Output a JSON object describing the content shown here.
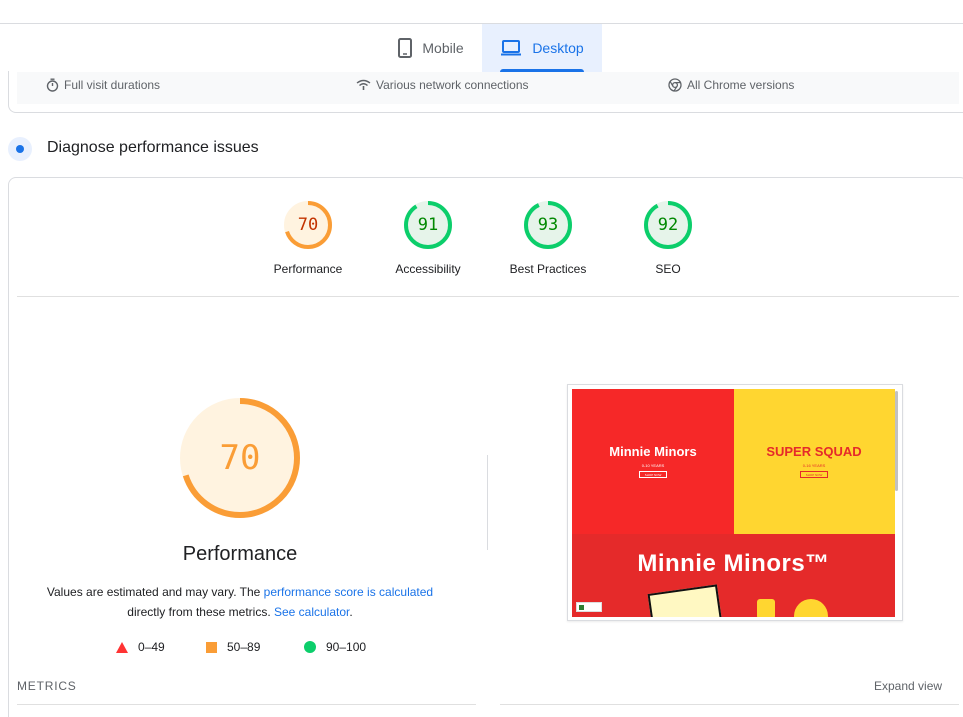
{
  "tabs": {
    "mobile": {
      "label": "Mobile",
      "icon": "phone-icon"
    },
    "desktop": {
      "label": "Desktop",
      "icon": "laptop-icon",
      "selected": true
    }
  },
  "info_strip": {
    "items": [
      {
        "label": "Full visit durations",
        "icon": "stopwatch-icon"
      },
      {
        "label": "Various network connections",
        "icon": "wifi-icon"
      },
      {
        "label": "All Chrome versions",
        "icon": "chrome-icon"
      }
    ]
  },
  "diagnose": {
    "title": "Diagnose performance issues"
  },
  "scores": [
    {
      "value": "70",
      "label": "Performance",
      "score": 0.7,
      "status": "average"
    },
    {
      "value": "91",
      "label": "Accessibility",
      "score": 0.91,
      "status": "good"
    },
    {
      "value": "93",
      "label": "Best Practices",
      "score": 0.93,
      "status": "good"
    },
    {
      "value": "92",
      "label": "SEO",
      "score": 0.92,
      "status": "good"
    }
  ],
  "colors": {
    "average": "#fa9d36",
    "average_bg": "#fff3e0",
    "average_text": "#c33300",
    "good": "#0cce6b",
    "good_bg": "#e6f4ea",
    "good_text": "#008800",
    "poor": "#ff3333",
    "link": "#1a73e8"
  },
  "performance_detail": {
    "score": "70",
    "score_fraction": 0.7,
    "title": "Performance",
    "desc_prefix": "Values are estimated and may vary. The ",
    "desc_link1": "performance score is calculated",
    "desc_middle": " directly from these metrics. ",
    "desc_link2": "See calculator",
    "desc_suffix": "."
  },
  "legend": [
    {
      "shape": "triangle",
      "label": "0–49"
    },
    {
      "shape": "square",
      "label": "50–89"
    },
    {
      "shape": "circle",
      "label": "90–100"
    }
  ],
  "screenshot": {
    "brand_left": "Minnie Minors",
    "brand_left_sub": "0-10 YEARS",
    "brand_right": "SUPER SQUAD",
    "brand_right_sub": "0-16 YEARS",
    "shop_btn": "SHOP NOW",
    "brand_bottom": "Minnie Minors™"
  },
  "metrics": {
    "label": "METRICS",
    "expand": "Expand view"
  }
}
